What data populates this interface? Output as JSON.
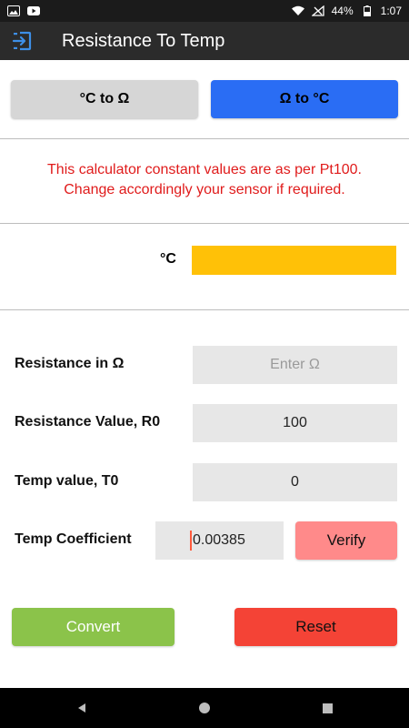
{
  "status_bar": {
    "battery": "44%",
    "time": "1:07"
  },
  "app_bar": {
    "title": "Resistance To Temp",
    "back_icon": "exit-arrow-icon"
  },
  "mode_buttons": {
    "c_to_ohm": "°C to Ω",
    "ohm_to_c": "Ω to °C"
  },
  "notice": {
    "line1": "This calculator constant values are as per Pt100.",
    "line2": "Change accordingly your sensor if required."
  },
  "result": {
    "label": "°C",
    "value": ""
  },
  "form": {
    "resistance": {
      "label": "Resistance in Ω",
      "placeholder": "Enter Ω",
      "value": ""
    },
    "r0": {
      "label": "Resistance Value, R0",
      "value": "100"
    },
    "t0": {
      "label": "Temp value, T0",
      "value": "0"
    },
    "coefficient": {
      "label": "Temp Coefficient",
      "value": "0.00385"
    }
  },
  "buttons": {
    "verify": "Verify",
    "convert": "Convert",
    "reset": "Reset"
  },
  "colors": {
    "accent_blue": "#2a6df4",
    "result_yellow": "#ffc107",
    "convert_green": "#8bc34a",
    "reset_red": "#f44336",
    "verify_pink": "#ff8a8a",
    "notice_red": "#e01b1b"
  }
}
